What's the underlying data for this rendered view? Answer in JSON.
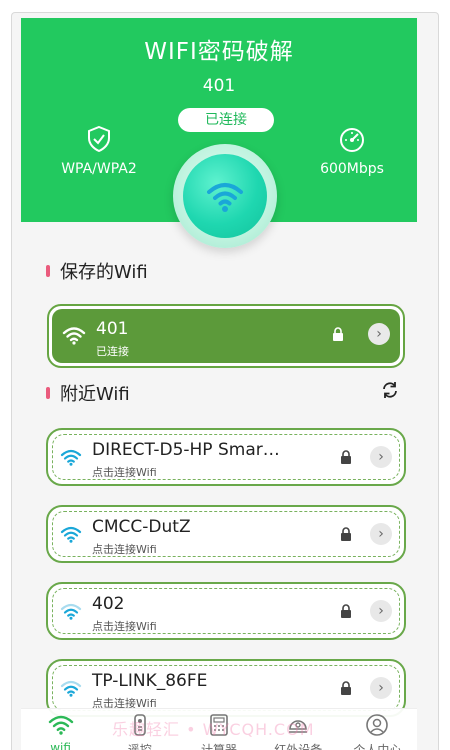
{
  "header": {
    "title": "WIFI密码破解",
    "ssid": "401",
    "status": "已连接",
    "security": "WPA/WPA2",
    "speed": "600Mbps"
  },
  "sections": {
    "saved_title": "保存的Wifi",
    "nearby_title": "附近Wifi"
  },
  "saved_network": {
    "name": "401",
    "status": "已连接"
  },
  "nearby_networks": [
    {
      "name": "DIRECT-D5-HP  Smar…",
      "action": "点击连接Wifi"
    },
    {
      "name": "CMCC-DutZ",
      "action": "点击连接Wifi"
    },
    {
      "name": "402",
      "action": "点击连接Wifi"
    },
    {
      "name": "TP-LINK_86FE",
      "action": "点击连接Wifi"
    }
  ],
  "tabs": [
    {
      "label": "wifi",
      "icon": "wifi-icon",
      "active": true
    },
    {
      "label": "遥控",
      "icon": "remote-icon"
    },
    {
      "label": "计算器",
      "icon": "calculator-icon"
    },
    {
      "label": "红外设备",
      "icon": "infrared-icon"
    },
    {
      "label": "个人中心",
      "icon": "user-icon"
    }
  ],
  "watermark": "乐趣轻汇 • WYCQH.COM",
  "colors": {
    "header_green": "#22c95f",
    "saved_card_green": "#5c9a3a",
    "card_border": "#69a84a",
    "wifi_blue": "#1aa7d8",
    "accent_pink": "#ea5b7d"
  }
}
